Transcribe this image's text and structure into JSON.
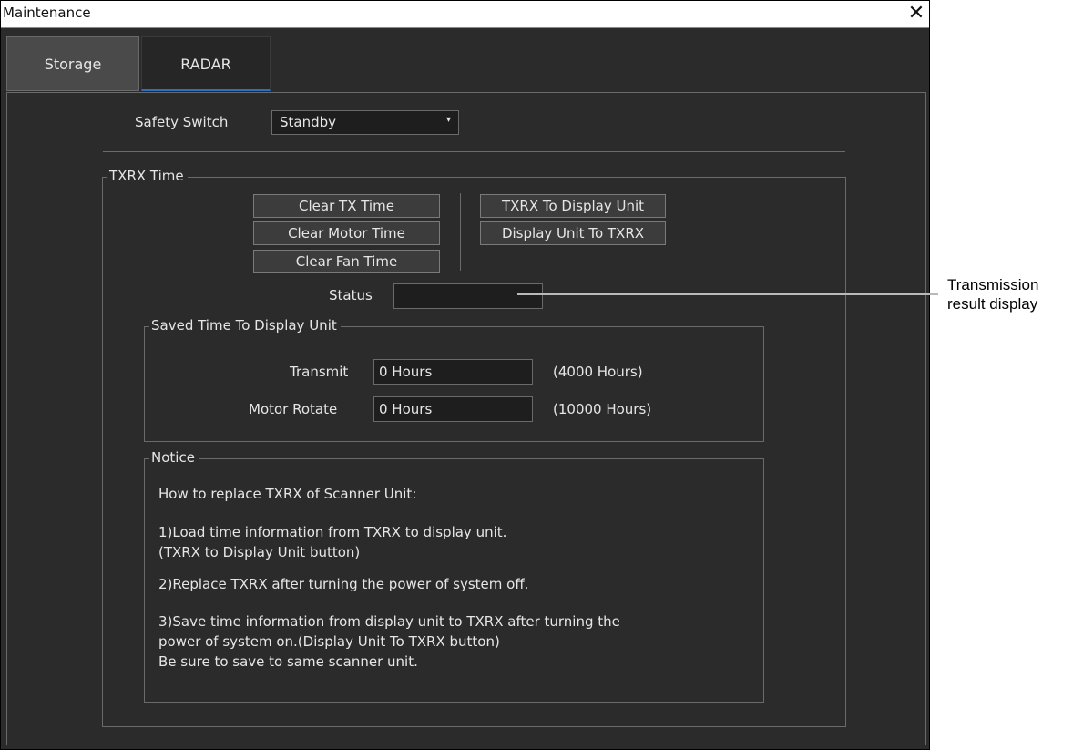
{
  "window": {
    "title": "Maintenance",
    "close_glyph": "✕"
  },
  "tabs": [
    {
      "label": "Storage"
    },
    {
      "label": "RADAR"
    }
  ],
  "safety": {
    "label": "Safety Switch",
    "value": "Standby",
    "arrow_glyph": "▾"
  },
  "txrx": {
    "title": "TXRX Time",
    "buttons": {
      "clear_tx": "Clear TX Time",
      "clear_motor": "Clear Motor Time",
      "clear_fan": "Clear Fan Time",
      "txrx_to_display": "TXRX To Display Unit",
      "display_to_txrx": "Display Unit To TXRX"
    },
    "status_label": "Status",
    "status_value": ""
  },
  "saved": {
    "title": "Saved Time To Display Unit",
    "transmit_label": "Transmit",
    "transmit_value": "0 Hours",
    "transmit_limit": "(4000 Hours)",
    "motor_label": "Motor Rotate",
    "motor_value": "0 Hours",
    "motor_limit": "(10000 Hours)"
  },
  "notice": {
    "title": "Notice",
    "lines": [
      "How to replace TXRX of Scanner Unit:",
      "1)Load time information from TXRX to display unit.",
      " (TXRX to Display Unit button)",
      "2)Replace TXRX after turning the power of system off.",
      "3)Save time information from display unit to TXRX after turning the",
      " power of system on.(Display Unit To TXRX button)",
      " Be sure to save to same scanner unit."
    ]
  },
  "callout": {
    "line1": "Transmission",
    "line2": "result display"
  }
}
